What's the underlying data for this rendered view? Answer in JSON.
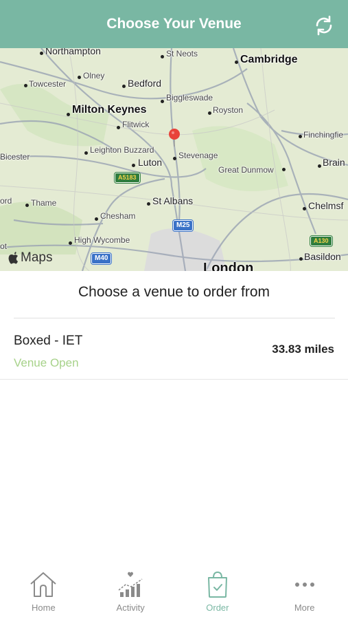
{
  "header": {
    "title": "Choose Your Venue",
    "refresh_icon": "refresh-icon"
  },
  "map": {
    "attribution": "Maps",
    "places": [
      {
        "name": "Northampton",
        "kind": "mid"
      },
      {
        "name": "St Neots",
        "kind": "small"
      },
      {
        "name": "Cambridge",
        "kind": "major"
      },
      {
        "name": "Olney",
        "kind": "small"
      },
      {
        "name": "Towcester",
        "kind": "small"
      },
      {
        "name": "Bedford",
        "kind": "mid"
      },
      {
        "name": "Biggleswade",
        "kind": "small"
      },
      {
        "name": "Milton Keynes",
        "kind": "major"
      },
      {
        "name": "Royston",
        "kind": "small"
      },
      {
        "name": "Flitwick",
        "kind": "small"
      },
      {
        "name": "Finchingfie",
        "kind": "small"
      },
      {
        "name": "Bicester",
        "kind": "small"
      },
      {
        "name": "Leighton Buzzard",
        "kind": "small"
      },
      {
        "name": "Stevenage",
        "kind": "small"
      },
      {
        "name": "Luton",
        "kind": "mid"
      },
      {
        "name": "Great Dunmow",
        "kind": "small"
      },
      {
        "name": "Brain",
        "kind": "small"
      },
      {
        "name": "ord",
        "kind": "small"
      },
      {
        "name": "Thame",
        "kind": "small"
      },
      {
        "name": "St Albans",
        "kind": "mid"
      },
      {
        "name": "Chelmsf",
        "kind": "mid"
      },
      {
        "name": "Chesham",
        "kind": "small"
      },
      {
        "name": "High Wycombe",
        "kind": "small"
      },
      {
        "name": "ot",
        "kind": "small"
      },
      {
        "name": "Basildon",
        "kind": "small"
      },
      {
        "name": "London",
        "kind": "major"
      }
    ],
    "roads": {
      "a5183": "A5183",
      "m25": "M25",
      "a130": "A130",
      "m40": "M40"
    }
  },
  "section_title": "Choose a venue to order from",
  "venues": [
    {
      "name": "Boxed - IET",
      "status": "Venue Open",
      "distance": "33.83 miles"
    }
  ],
  "tabs": [
    {
      "label": "Home",
      "icon": "home-icon"
    },
    {
      "label": "Activity",
      "icon": "activity-icon"
    },
    {
      "label": "Order",
      "icon": "order-bag-icon",
      "active": true
    },
    {
      "label": "More",
      "icon": "more-icon"
    }
  ],
  "colors": {
    "brand": "#79b7a3",
    "status_open": "#a7d28a"
  }
}
